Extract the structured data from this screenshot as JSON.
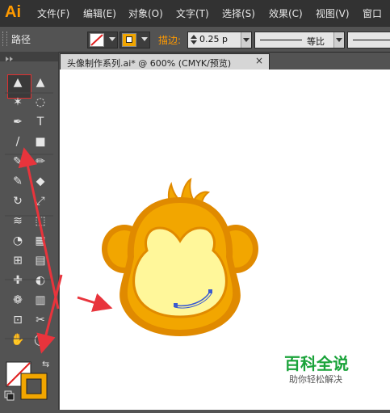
{
  "app": {
    "logo_text": "Ai"
  },
  "menu": {
    "items": [
      "文件(F)",
      "编辑(E)",
      "对象(O)",
      "文字(T)",
      "选择(S)",
      "效果(C)",
      "视图(V)",
      "窗口"
    ]
  },
  "control_bar": {
    "selection_label": "路径",
    "stroke_label": "描边:",
    "stroke_weight": "0.25 p",
    "profile_label": "等比"
  },
  "document_tab": {
    "title": "头像制作系列.ai* @ 600% (CMYK/预览)",
    "close_glyph": "×"
  },
  "watermark": {
    "title": "百科全说",
    "subtitle": "助你轻松解决"
  },
  "colors": {
    "accent": "#ff9a00",
    "monkey_outer": "#f2a600",
    "monkey_rim": "#e08a00",
    "monkey_face": "#fff79a",
    "annotation_arrow": "#e8343c",
    "watermark_green": "#1aa33a",
    "selected_path": "#3a5bd0"
  },
  "tools": [
    "selection-tool",
    "direct-selection-tool",
    "magic-wand-tool",
    "lasso-tool",
    "pen-tool",
    "type-tool",
    "line-segment-tool",
    "rectangle-tool",
    "paintbrush-tool",
    "pencil-tool",
    "blob-brush-tool",
    "eraser-tool",
    "rotate-tool",
    "scale-tool",
    "width-tool",
    "free-transform-tool",
    "shape-builder-tool",
    "perspective-grid-tool",
    "mesh-tool",
    "gradient-tool",
    "eyedropper-tool",
    "blend-tool",
    "symbol-sprayer-tool",
    "column-graph-tool",
    "artboard-tool",
    "slice-tool",
    "hand-tool",
    "zoom-tool"
  ]
}
